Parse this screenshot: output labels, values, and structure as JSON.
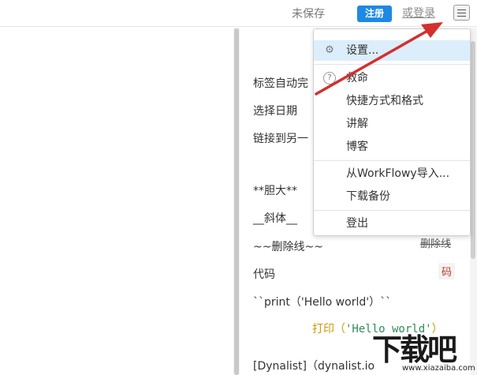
{
  "topbar": {
    "status": "未保存",
    "signup_label": "注册",
    "login_label": "或登录"
  },
  "document": {
    "lines": [
      "标签自动完",
      "选择日期",
      "链接到另一",
      "**胆大**",
      "__斜体__",
      "~~删除线~~",
      "代码",
      "``print（'Hello world'）``",
      "[Dynalist]（dynalist.io"
    ],
    "strike_preview": "删除线",
    "code_preview": "码",
    "print_preview_prefix": "打印（",
    "print_preview_string": "'Hello world'",
    "print_preview_suffix": "）"
  },
  "menu": {
    "items": [
      {
        "label": "设置...",
        "icon": "gear-icon"
      },
      {
        "label": "救命",
        "icon": "help-icon"
      },
      {
        "label": "快捷方式和格式"
      },
      {
        "label": "讲解"
      },
      {
        "label": "博客"
      },
      {
        "label": "从WorkFlowy导入..."
      },
      {
        "label": "下载备份"
      },
      {
        "label": "登出"
      }
    ]
  },
  "watermark": {
    "cn": "下载吧",
    "en": "www.xiazaiba.com"
  },
  "colors": {
    "accent": "#1e88e5",
    "highlight": "#dceefb",
    "arrow": "#d32f2f"
  }
}
